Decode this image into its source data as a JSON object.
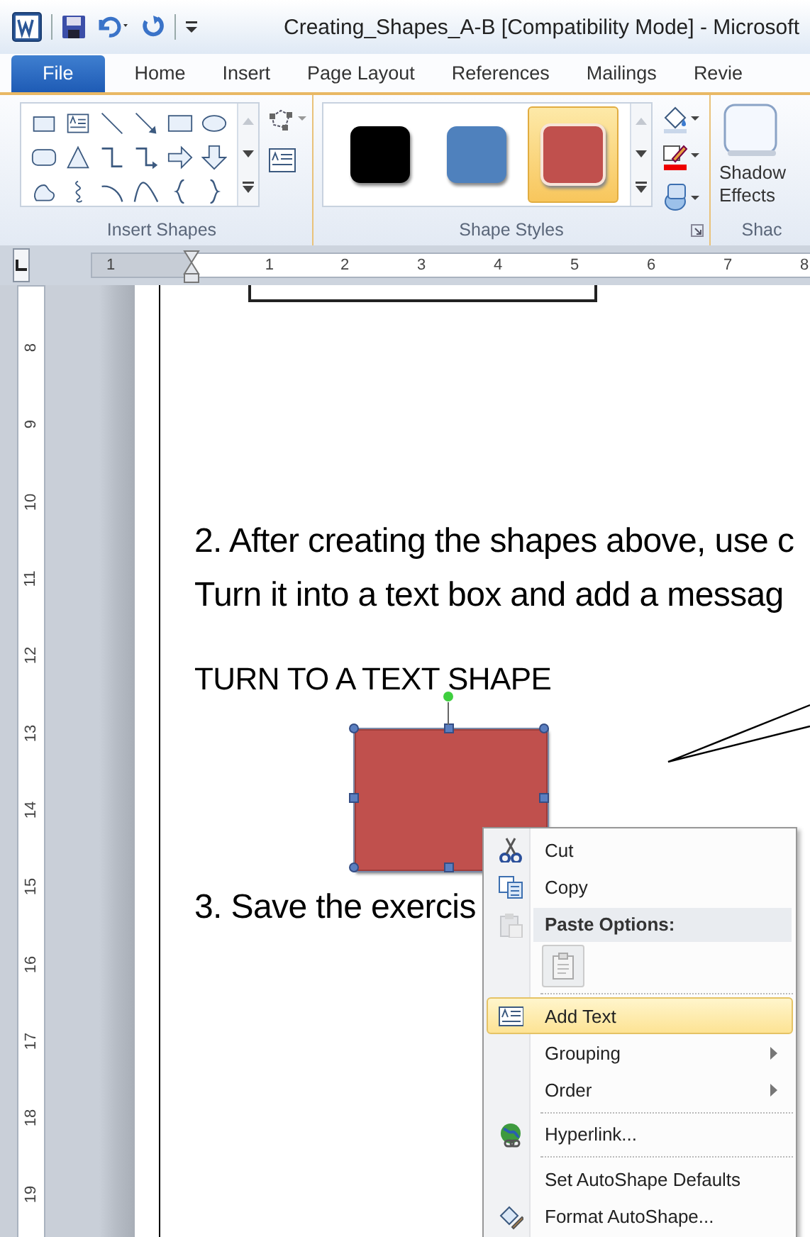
{
  "title_bar": {
    "title": "Creating_Shapes_A-B [Compatibility Mode]  -  Microsoft"
  },
  "tabs": [
    {
      "label": "File",
      "kind": "file"
    },
    {
      "label": "Home",
      "kind": "tab"
    },
    {
      "label": "Insert",
      "kind": "tab"
    },
    {
      "label": "Page Layout",
      "kind": "tab"
    },
    {
      "label": "References",
      "kind": "tab"
    },
    {
      "label": "Mailings",
      "kind": "tab"
    },
    {
      "label": "Revie",
      "kind": "tab"
    }
  ],
  "ribbon": {
    "groups": [
      {
        "kind": "shapes",
        "label": "Insert Shapes"
      },
      {
        "kind": "styles",
        "label": "Shape Styles",
        "styles": [
          {
            "color": "#000000",
            "selected": false
          },
          {
            "color": "#4f81bd",
            "selected": false
          },
          {
            "color": "#c0504d",
            "selected": true
          }
        ]
      },
      {
        "kind": "shadow",
        "label": "Shac",
        "button": "Shadow Effects"
      }
    ]
  },
  "horizontal_ruler": {
    "labels": [
      "1",
      "1",
      "2",
      "3",
      "4",
      "5",
      "6",
      "7",
      "8"
    ]
  },
  "vertical_ruler": {
    "labels": [
      "8",
      "9",
      "10",
      "11",
      "12",
      "13",
      "14",
      "15",
      "16",
      "17",
      "18",
      "19"
    ]
  },
  "document": {
    "paragraphs": [
      "2. After creating the shapes above, use c",
      "Turn it into a text box and add a messag"
    ],
    "heading": "TURN TO A TEXT SHAPE",
    "shape": {
      "color": "#c0504d",
      "selected": true
    },
    "after": "3. Save the exercis"
  },
  "context_menu": {
    "items": [
      {
        "kind": "command",
        "label": "Cut",
        "selected": false,
        "submenu": false
      },
      {
        "kind": "command",
        "label": "Copy",
        "selected": false,
        "submenu": false
      },
      {
        "kind": "header",
        "label": "Paste Options:",
        "selected": false
      },
      {
        "kind": "paste",
        "selected": false
      },
      {
        "kind": "separator"
      },
      {
        "kind": "command",
        "label": "Add Text",
        "selected": true,
        "submenu": false
      },
      {
        "kind": "command",
        "label": "Grouping",
        "selected": false,
        "submenu": true
      },
      {
        "kind": "command",
        "label": "Order",
        "selected": false,
        "submenu": true
      },
      {
        "kind": "separator"
      },
      {
        "kind": "command",
        "label": "Hyperlink...",
        "selected": false,
        "submenu": false
      },
      {
        "kind": "separator"
      },
      {
        "kind": "command",
        "label": "Set AutoShape Defaults",
        "selected": false,
        "submenu": false
      },
      {
        "kind": "command",
        "label": "Format AutoShape...",
        "selected": false,
        "submenu": false
      }
    ]
  }
}
